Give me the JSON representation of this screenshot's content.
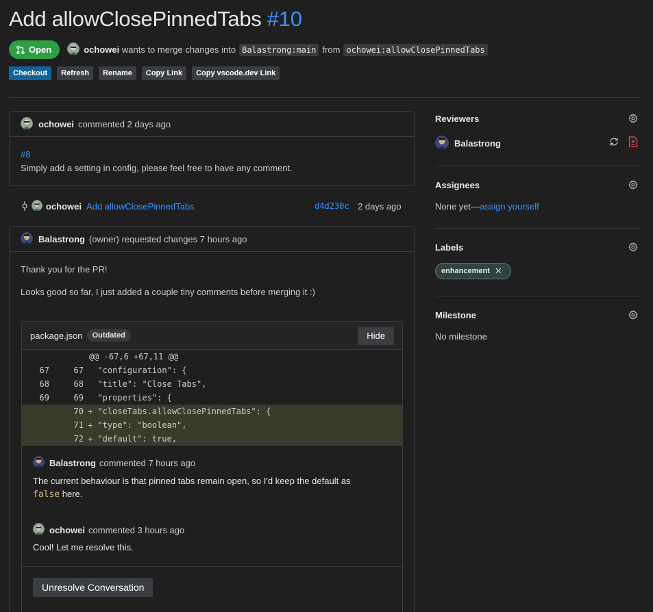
{
  "header": {
    "title": "Add allowClosePinnedTabs",
    "number": "#10",
    "status": "Open",
    "author": "ochowei",
    "merge_text": "wants to merge changes into",
    "target_branch": "Balastrong:main",
    "from_text": "from",
    "source_branch": "ochowei:allowClosePinnedTabs"
  },
  "actions": {
    "checkout": "Checkout",
    "refresh": "Refresh",
    "rename": "Rename",
    "copy_link": "Copy Link",
    "copy_vscode": "Copy vscode.dev Link"
  },
  "first_comment": {
    "author": "ochowei",
    "meta": "commented 2 days ago",
    "link": "#8",
    "text": "Simply add a setting in config, please feel free to have any comment."
  },
  "commit": {
    "author": "ochowei",
    "message": "Add allowClosePinnedTabs",
    "sha": "d4d230c",
    "time": "2 days ago"
  },
  "review": {
    "author": "Balastrong",
    "meta": "(owner) requested changes 7 hours ago",
    "para1": "Thank you for the PR!",
    "para2": "Looks good so far, I just added a couple tiny comments before merging it :)",
    "file": "package.json",
    "outdated": "Outdated",
    "hide": "Hide",
    "diff": [
      {
        "type": "hunk",
        "a": "",
        "b": "",
        "code": "@@ -67,6 +67,11 @@"
      },
      {
        "type": "ctx",
        "a": "67",
        "b": "67",
        "code": "  \"configuration\": {"
      },
      {
        "type": "ctx",
        "a": "68",
        "b": "68",
        "code": "  \"title\": \"Close Tabs\","
      },
      {
        "type": "ctx",
        "a": "69",
        "b": "69",
        "code": "  \"properties\": {"
      },
      {
        "type": "add",
        "a": "",
        "b": "70",
        "code": "+ \"closeTabs.allowClosePinnedTabs\": {"
      },
      {
        "type": "add",
        "a": "",
        "b": "71",
        "code": "+ \"type\": \"boolean\","
      },
      {
        "type": "add",
        "a": "",
        "b": "72",
        "code": "+ \"default\": true,"
      }
    ],
    "thread": [
      {
        "author": "Balastrong",
        "meta": "commented 7 hours ago",
        "text_before": "The current behaviour is that pinned tabs remain open, so I'd keep the default as",
        "code": "false",
        "text_after": "here."
      },
      {
        "author": "ochowei",
        "meta": "commented 3 hours ago",
        "text": "Cool! Let me resolve this."
      }
    ],
    "unresolve": "Unresolve Conversation"
  },
  "sidebar": {
    "reviewers_title": "Reviewers",
    "reviewer": "Balastrong",
    "assignees_title": "Assignees",
    "assignees_none": "None yet—",
    "assign_yourself": "assign yourself",
    "labels_title": "Labels",
    "label": "enhancement",
    "milestone_title": "Milestone",
    "milestone_value": "No milestone"
  },
  "colors": {
    "background": "#1f1f1f",
    "link": "#3794ff",
    "open_badge": "#2ea043",
    "primary_button": "#0e639c",
    "added_line": "#373d29"
  }
}
